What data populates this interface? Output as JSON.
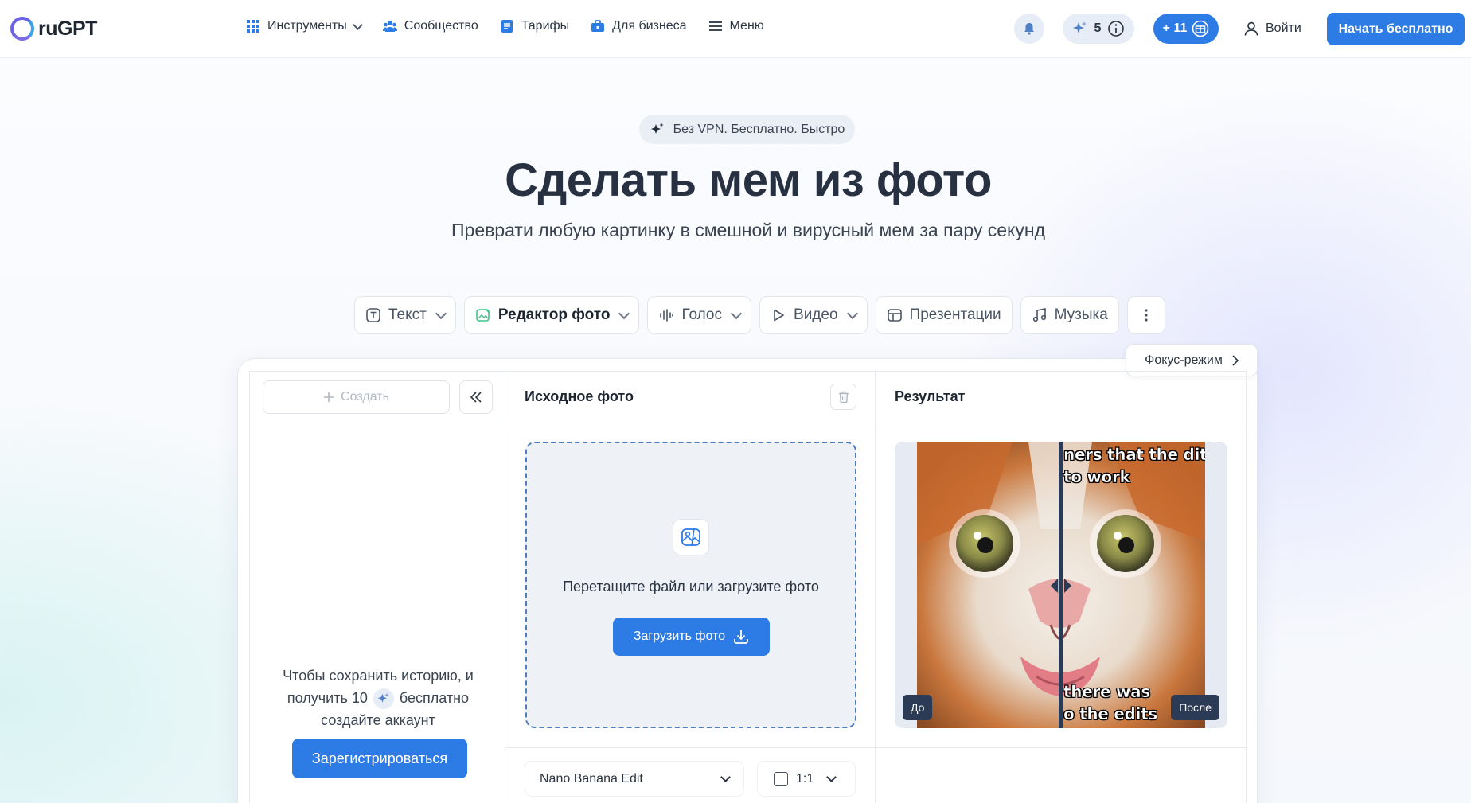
{
  "header": {
    "logo": "ruGPT",
    "nav": [
      {
        "label": "Инструменты",
        "icon": "grid-icon"
      },
      {
        "label": "Сообщество",
        "icon": "community-icon"
      },
      {
        "label": "Тарифы",
        "icon": "tariffs-icon"
      },
      {
        "label": "Для бизнеса",
        "icon": "business-icon"
      },
      {
        "label": "Меню",
        "icon": "menu-icon"
      }
    ],
    "balance": "5",
    "bonus": "+ 11",
    "login": "Войти",
    "start": "Начать бесплатно"
  },
  "hero": {
    "badge": "Без VPN. Бесплатно. Быстро",
    "title": "Сделать мем из фото",
    "subtitle": "Преврати любую картинку в смешной и вирусный мем за пару секунд"
  },
  "tools": [
    {
      "label": "Текст"
    },
    {
      "label": "Редактор фото"
    },
    {
      "label": "Голос"
    },
    {
      "label": "Видео"
    },
    {
      "label": "Презентации"
    },
    {
      "label": "Музыка"
    }
  ],
  "focus": "Фокус-режим",
  "history": {
    "create": "Создать",
    "line1": "Чтобы сохранить историю, и",
    "line2a": "получить 10",
    "line2b": "бесплатно",
    "line3": "создайте аккаунт",
    "register": "Зарегистрироваться"
  },
  "source": {
    "title": "Исходное фото",
    "drop": "Перетащите файл или загрузите фото",
    "upload": "Загрузить фото",
    "model": "Nano Banana Edit",
    "ratio": "1:1"
  },
  "result": {
    "title": "Результат",
    "before": "До",
    "after": "После",
    "meme_top1": "ners that the  dits",
    "meme_top2": "to work",
    "meme_bottom1": "there was",
    "meme_bottom2": "o the edits"
  },
  "colors": {
    "accent": "#2d7be5",
    "dark": "#273142"
  }
}
